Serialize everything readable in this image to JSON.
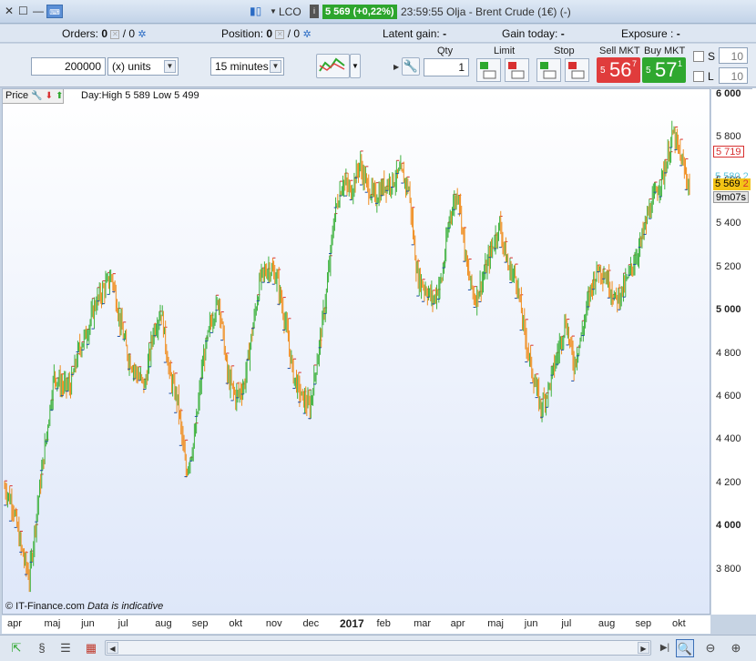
{
  "titlebar": {
    "symbol": "LCO",
    "price_badge": "5 569 (+0,22%)",
    "info": "23:59:55 Olja - Brent Crude (1€) (-)"
  },
  "inforow": {
    "orders_label": "Orders:",
    "orders_value": "0",
    "orders_sep": "/ 0",
    "position_label": "Position:",
    "position_value": "0",
    "position_sep": "/ 0",
    "latent_label": "Latent gain:",
    "latent_value": "-",
    "gain_today_label": "Gain today:",
    "gain_today_value": "-",
    "exposure_label": "Exposure :",
    "exposure_value": "-"
  },
  "toolbar": {
    "quantity": "200000",
    "units": "(x) units",
    "timeframe": "15 minutes",
    "qty_label": "Qty",
    "qty_value": "1",
    "limit_label": "Limit",
    "stop_label": "Stop",
    "sell_label": "Sell MKT",
    "buy_label": "Buy MKT",
    "sell_small": "5",
    "sell_big": "56",
    "sell_sup": "7",
    "buy_small": "5",
    "buy_big": "57",
    "buy_sup": "1",
    "s_label": "S",
    "s_value": "10",
    "l_label": "L",
    "l_value": "10"
  },
  "chart": {
    "price_label": "Price",
    "day_info": "Day:High 5 589 Low 5 499",
    "copyright": "© IT-Finance.com",
    "disclaimer": "Data is indicative",
    "tag_high": "5 719",
    "tag_mid": "5 580",
    "tag_mid_suffix": "2",
    "tag_last": "5 569",
    "tag_last_suffix": "2",
    "countdown": "9m07s"
  },
  "chart_data": {
    "type": "ohlc",
    "title": "",
    "xlabel": "",
    "ylabel": "",
    "ylim": [
      3600,
      6000
    ],
    "yticks": [
      "6 000",
      "5 800",
      "5 600",
      "5 400",
      "5 200",
      "5 000",
      "4 800",
      "4 600",
      "4 400",
      "4 200",
      "4 000",
      "3 800"
    ],
    "bold_yticks": [
      "6 000",
      "5 000",
      "4 000"
    ],
    "x_tick_labels": [
      "apr",
      "maj",
      "jun",
      "jul",
      "aug",
      "sep",
      "okt",
      "nov",
      "dec",
      "2017",
      "feb",
      "mar",
      "apr",
      "maj",
      "jun",
      "jul",
      "aug",
      "sep",
      "okt"
    ],
    "bold_xticks": [
      "2017"
    ],
    "series": [
      {
        "name": "",
        "close_path": [
          [
            0,
            4180
          ],
          [
            4,
            4100
          ],
          [
            8,
            3900
          ],
          [
            12,
            3760
          ],
          [
            16,
            4100
          ],
          [
            20,
            4400
          ],
          [
            24,
            4700
          ],
          [
            28,
            4650
          ],
          [
            32,
            4650
          ],
          [
            36,
            4820
          ],
          [
            40,
            4900
          ],
          [
            44,
            5030
          ],
          [
            48,
            5100
          ],
          [
            52,
            5160
          ],
          [
            56,
            4950
          ],
          [
            60,
            4780
          ],
          [
            64,
            4710
          ],
          [
            68,
            4650
          ],
          [
            72,
            4900
          ],
          [
            76,
            5000
          ],
          [
            80,
            4700
          ],
          [
            84,
            4580
          ],
          [
            88,
            4250
          ],
          [
            92,
            4400
          ],
          [
            96,
            4750
          ],
          [
            100,
            4950
          ],
          [
            104,
            5050
          ],
          [
            108,
            4700
          ],
          [
            112,
            4600
          ],
          [
            116,
            4650
          ],
          [
            120,
            4900
          ],
          [
            124,
            5150
          ],
          [
            128,
            5200
          ],
          [
            132,
            5150
          ],
          [
            136,
            4950
          ],
          [
            140,
            4700
          ],
          [
            144,
            4600
          ],
          [
            148,
            4550
          ],
          [
            152,
            4800
          ],
          [
            156,
            5080
          ],
          [
            160,
            5450
          ],
          [
            164,
            5600
          ],
          [
            168,
            5550
          ],
          [
            172,
            5680
          ],
          [
            176,
            5570
          ],
          [
            180,
            5520
          ],
          [
            184,
            5580
          ],
          [
            188,
            5600
          ],
          [
            192,
            5640
          ],
          [
            196,
            5560
          ],
          [
            200,
            5160
          ],
          [
            204,
            5100
          ],
          [
            208,
            5050
          ],
          [
            212,
            5150
          ],
          [
            216,
            5450
          ],
          [
            220,
            5550
          ],
          [
            224,
            5200
          ],
          [
            228,
            5050
          ],
          [
            232,
            5150
          ],
          [
            236,
            5280
          ],
          [
            240,
            5400
          ],
          [
            244,
            5200
          ],
          [
            248,
            5150
          ],
          [
            252,
            4900
          ],
          [
            256,
            4700
          ],
          [
            260,
            4550
          ],
          [
            264,
            4650
          ],
          [
            268,
            4800
          ],
          [
            272,
            4950
          ],
          [
            276,
            4750
          ],
          [
            280,
            4900
          ],
          [
            284,
            5100
          ],
          [
            288,
            5200
          ],
          [
            292,
            5150
          ],
          [
            296,
            5050
          ],
          [
            300,
            5100
          ],
          [
            304,
            5200
          ],
          [
            308,
            5300
          ],
          [
            312,
            5450
          ],
          [
            316,
            5550
          ],
          [
            320,
            5650
          ],
          [
            324,
            5820
          ],
          [
            328,
            5700
          ],
          [
            332,
            5569
          ]
        ]
      }
    ],
    "grid": false,
    "legend": "none"
  }
}
